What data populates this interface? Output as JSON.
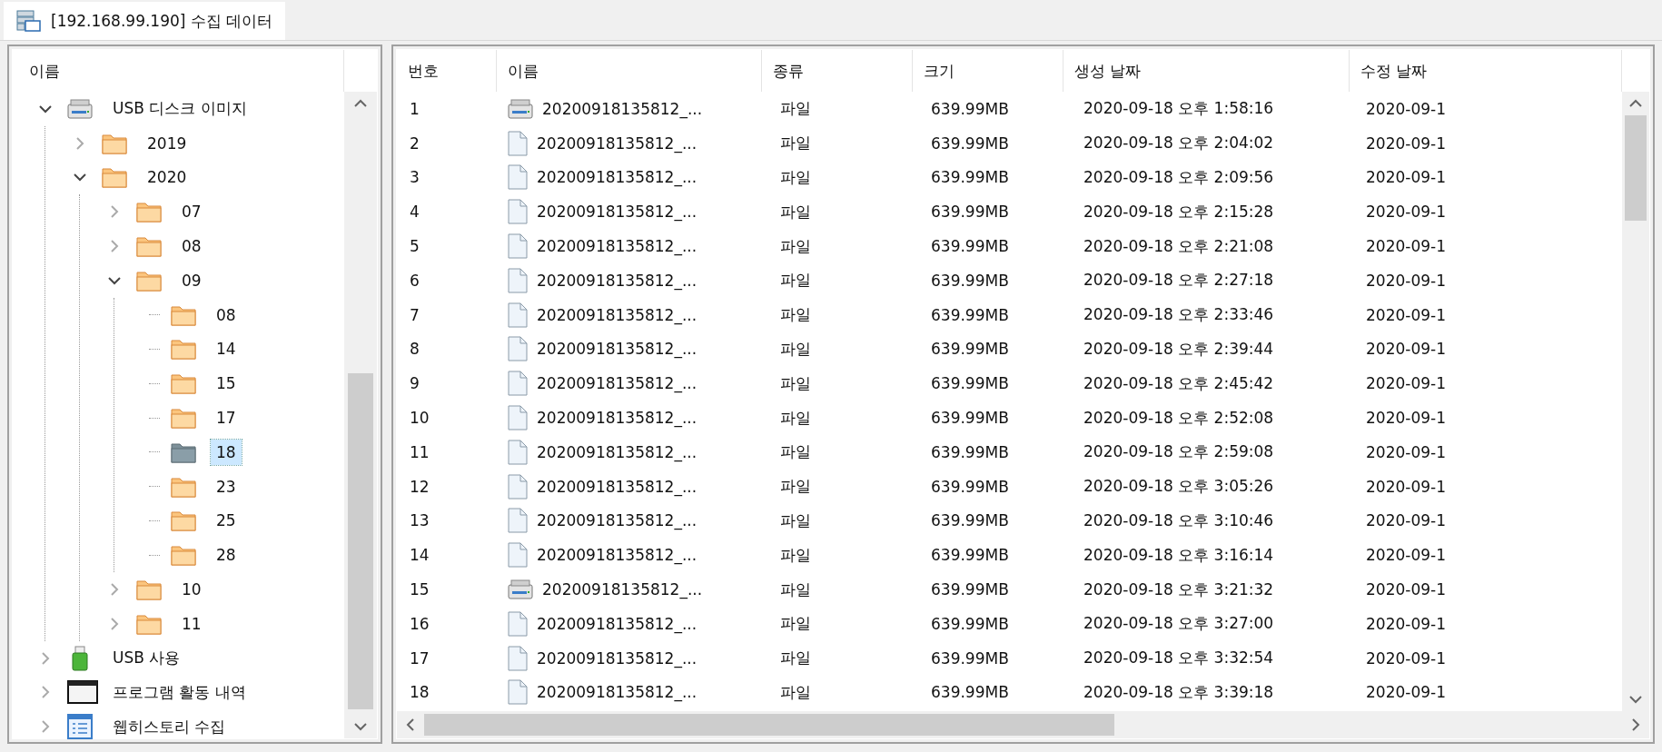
{
  "tabs": [
    {
      "label": "[192.168.99.190] 수집 데이터",
      "selected": true
    }
  ],
  "tree": {
    "column": "이름",
    "items": [
      {
        "label": "USB 디스크 이미지",
        "kind": "drive",
        "expanded": true,
        "selected": false,
        "children": [
          {
            "label": "2019",
            "kind": "folder",
            "expanded": false,
            "selected": false
          },
          {
            "label": "2020",
            "kind": "folder",
            "expanded": true,
            "selected": false,
            "children": [
              {
                "label": "07",
                "kind": "folder",
                "expanded": false,
                "selected": false
              },
              {
                "label": "08",
                "kind": "folder",
                "expanded": false,
                "selected": false
              },
              {
                "label": "09",
                "kind": "folder",
                "expanded": true,
                "selected": false,
                "children": [
                  {
                    "label": "08",
                    "kind": "folder",
                    "selected": false
                  },
                  {
                    "label": "14",
                    "kind": "folder",
                    "selected": false
                  },
                  {
                    "label": "15",
                    "kind": "folder",
                    "selected": false
                  },
                  {
                    "label": "17",
                    "kind": "folder",
                    "selected": false
                  },
                  {
                    "label": "18",
                    "kind": "folder",
                    "selected": true
                  },
                  {
                    "label": "23",
                    "kind": "folder",
                    "selected": false
                  },
                  {
                    "label": "25",
                    "kind": "folder",
                    "selected": false
                  },
                  {
                    "label": "28",
                    "kind": "folder",
                    "selected": false
                  }
                ]
              },
              {
                "label": "10",
                "kind": "folder",
                "expanded": false,
                "selected": false
              },
              {
                "label": "11",
                "kind": "folder",
                "expanded": false,
                "selected": false
              }
            ]
          }
        ]
      },
      {
        "label": "USB 사용",
        "kind": "usb",
        "expanded": false,
        "selected": false
      },
      {
        "label": "프로그램 활동 내역",
        "kind": "program",
        "expanded": false,
        "selected": false
      },
      {
        "label": "웹히스토리 수집",
        "kind": "web",
        "expanded": false,
        "selected": false
      }
    ]
  },
  "table": {
    "columns": [
      "번호",
      "이름",
      "종류",
      "크기",
      "생성 날짜",
      "수정 날짜"
    ],
    "rows": [
      {
        "no": "1",
        "kind": "drive",
        "name": "20200918135812_...",
        "type": "파일",
        "size": "639.99MB",
        "created": "2020-09-18 오후 1:58:16",
        "modified": "2020-09-1"
      },
      {
        "no": "2",
        "kind": "file",
        "name": "20200918135812_...",
        "type": "파일",
        "size": "639.99MB",
        "created": "2020-09-18 오후 2:04:02",
        "modified": "2020-09-1"
      },
      {
        "no": "3",
        "kind": "file",
        "name": "20200918135812_...",
        "type": "파일",
        "size": "639.99MB",
        "created": "2020-09-18 오후 2:09:56",
        "modified": "2020-09-1"
      },
      {
        "no": "4",
        "kind": "file",
        "name": "20200918135812_...",
        "type": "파일",
        "size": "639.99MB",
        "created": "2020-09-18 오후 2:15:28",
        "modified": "2020-09-1"
      },
      {
        "no": "5",
        "kind": "file",
        "name": "20200918135812_...",
        "type": "파일",
        "size": "639.99MB",
        "created": "2020-09-18 오후 2:21:08",
        "modified": "2020-09-1"
      },
      {
        "no": "6",
        "kind": "file",
        "name": "20200918135812_...",
        "type": "파일",
        "size": "639.99MB",
        "created": "2020-09-18 오후 2:27:18",
        "modified": "2020-09-1"
      },
      {
        "no": "7",
        "kind": "file",
        "name": "20200918135812_...",
        "type": "파일",
        "size": "639.99MB",
        "created": "2020-09-18 오후 2:33:46",
        "modified": "2020-09-1"
      },
      {
        "no": "8",
        "kind": "file",
        "name": "20200918135812_...",
        "type": "파일",
        "size": "639.99MB",
        "created": "2020-09-18 오후 2:39:44",
        "modified": "2020-09-1"
      },
      {
        "no": "9",
        "kind": "file",
        "name": "20200918135812_...",
        "type": "파일",
        "size": "639.99MB",
        "created": "2020-09-18 오후 2:45:42",
        "modified": "2020-09-1"
      },
      {
        "no": "10",
        "kind": "file",
        "name": "20200918135812_...",
        "type": "파일",
        "size": "639.99MB",
        "created": "2020-09-18 오후 2:52:08",
        "modified": "2020-09-1"
      },
      {
        "no": "11",
        "kind": "file",
        "name": "20200918135812_...",
        "type": "파일",
        "size": "639.99MB",
        "created": "2020-09-18 오후 2:59:08",
        "modified": "2020-09-1"
      },
      {
        "no": "12",
        "kind": "file",
        "name": "20200918135812_...",
        "type": "파일",
        "size": "639.99MB",
        "created": "2020-09-18 오후 3:05:26",
        "modified": "2020-09-1"
      },
      {
        "no": "13",
        "kind": "file",
        "name": "20200918135812_...",
        "type": "파일",
        "size": "639.99MB",
        "created": "2020-09-18 오후 3:10:46",
        "modified": "2020-09-1"
      },
      {
        "no": "14",
        "kind": "file",
        "name": "20200918135812_...",
        "type": "파일",
        "size": "639.99MB",
        "created": "2020-09-18 오후 3:16:14",
        "modified": "2020-09-1"
      },
      {
        "no": "15",
        "kind": "drive",
        "name": "20200918135812_...",
        "type": "파일",
        "size": "639.99MB",
        "created": "2020-09-18 오후 3:21:32",
        "modified": "2020-09-1"
      },
      {
        "no": "16",
        "kind": "file",
        "name": "20200918135812_...",
        "type": "파일",
        "size": "639.99MB",
        "created": "2020-09-18 오후 3:27:00",
        "modified": "2020-09-1"
      },
      {
        "no": "17",
        "kind": "file",
        "name": "20200918135812_...",
        "type": "파일",
        "size": "639.99MB",
        "created": "2020-09-18 오후 3:32:54",
        "modified": "2020-09-1"
      },
      {
        "no": "18",
        "kind": "file",
        "name": "20200918135812_...",
        "type": "파일",
        "size": "639.99MB",
        "created": "2020-09-18 오후 3:39:18",
        "modified": "2020-09-1"
      }
    ]
  }
}
